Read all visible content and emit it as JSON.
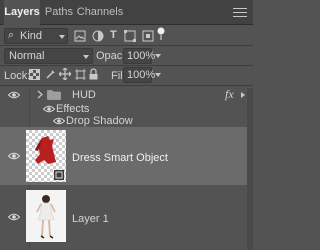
{
  "tabs": [
    {
      "label": "Layers",
      "active": true
    },
    {
      "label": "Paths",
      "active": false
    },
    {
      "label": "Channels",
      "active": false
    }
  ],
  "filter": {
    "search_glyph": "⌕",
    "kind_label": "Kind"
  },
  "blend": {
    "mode": "Normal",
    "opacity_label": "Opacity:",
    "opacity_value": "100%"
  },
  "lock": {
    "label": "Lock:",
    "fill_label": "Fill:",
    "fill_value": "100%"
  },
  "layers": {
    "hud": {
      "name": "HUD",
      "fx": "fx"
    },
    "effects_label": "Effects",
    "drop_shadow_label": "Drop Shadow",
    "dress": {
      "name": "Dress Smart Object"
    },
    "layer1": {
      "name": "Layer 1"
    }
  },
  "colors": {
    "panel_bg": "#535353",
    "selected_row": "#6b6b6b",
    "dress_red": "#b81f1f"
  }
}
